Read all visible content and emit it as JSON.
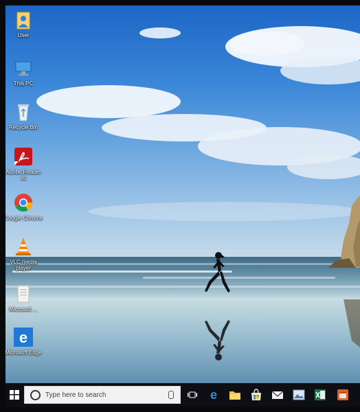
{
  "desktop": {
    "icons": [
      {
        "label": "User"
      },
      {
        "label": "This PC"
      },
      {
        "label": "Recycle Bin"
      },
      {
        "label": "Adobe Reader XI"
      },
      {
        "label": "Google Chrome"
      },
      {
        "label": "VLC media player"
      },
      {
        "label": "Microsoft ..."
      },
      {
        "label": "Microsoft Edge"
      }
    ]
  },
  "taskbar": {
    "search_placeholder": "Type here to search",
    "pinned": [
      {
        "icon": "task-view-icon"
      },
      {
        "icon": "edge-icon"
      },
      {
        "icon": "file-explorer-icon"
      },
      {
        "icon": "store-icon"
      },
      {
        "icon": "mail-icon"
      },
      {
        "icon": "photos-icon"
      },
      {
        "icon": "excel-icon"
      },
      {
        "icon": "app-icon"
      }
    ]
  },
  "colors": {
    "taskbar": "#0d0f14",
    "accent": "#1f7ad6"
  }
}
